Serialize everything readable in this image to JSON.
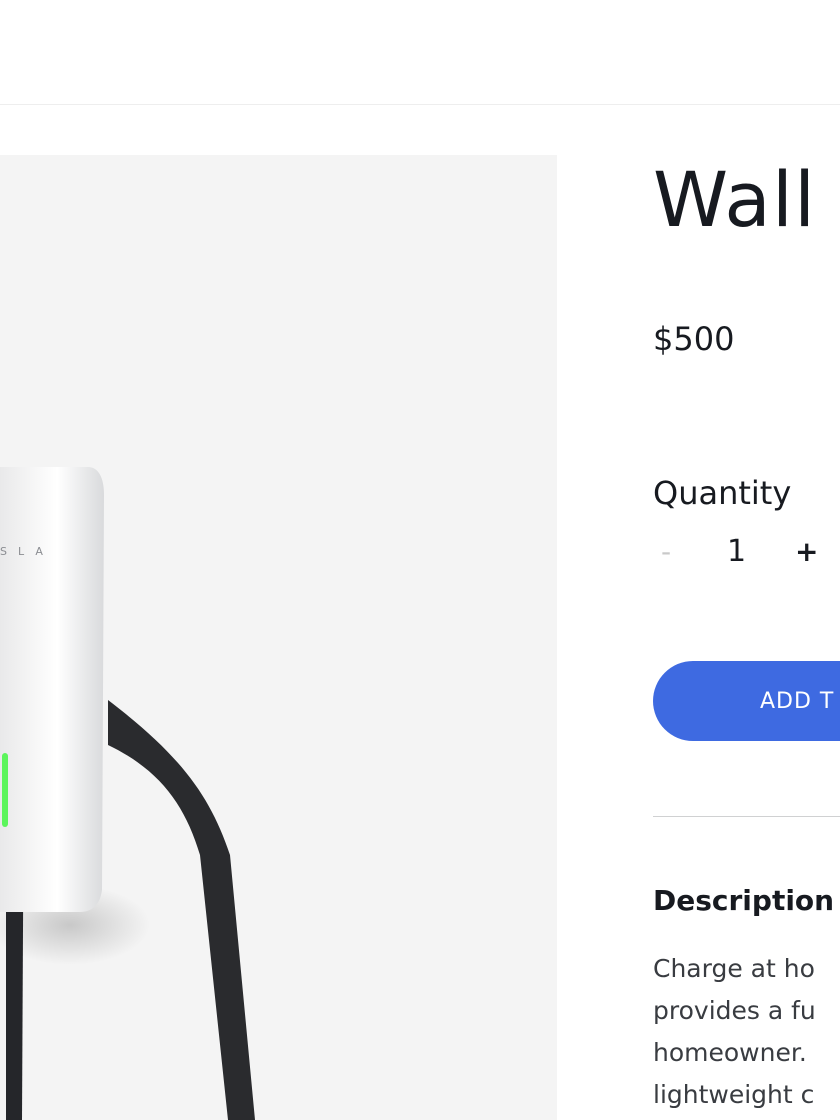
{
  "product": {
    "image_brand_text": "SLA",
    "title": "Wall",
    "price": "$500",
    "quantity": {
      "label": "Quantity",
      "decrement": "-",
      "value": "1",
      "increment": "+"
    },
    "add_to_cart_label": "ADD T",
    "description": {
      "heading": "Description",
      "lines": [
        "Charge at ho",
        "provides a fu",
        "homeowner.",
        "lightweight c"
      ]
    }
  },
  "colors": {
    "accent": "#3e6ae1",
    "text": "#171a20",
    "body_text": "#393c41",
    "image_background": "#f4f4f4",
    "status_light": "#5cf55c"
  }
}
